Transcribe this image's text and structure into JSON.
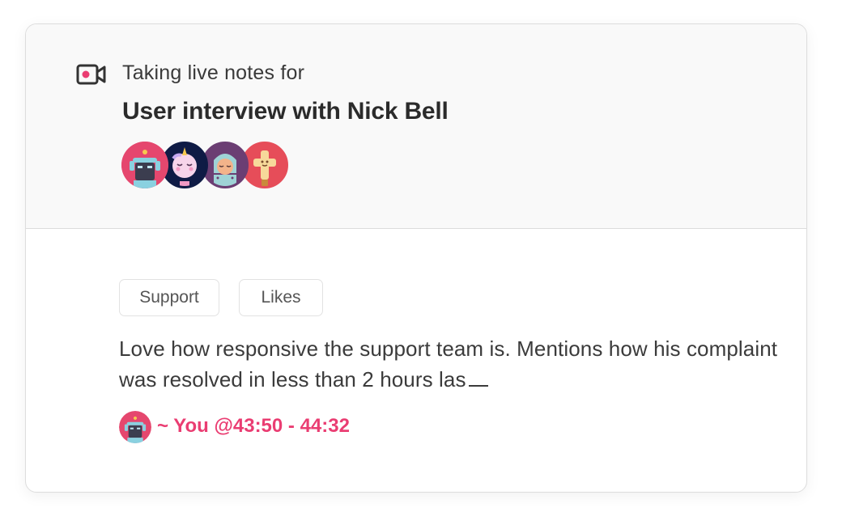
{
  "header": {
    "subtitle": "Taking live notes for",
    "title": "User interview with Nick Bell",
    "record_icon": "video-camera-record-icon",
    "participants": [
      {
        "name": "robot-avatar",
        "bg": "#e5476e"
      },
      {
        "name": "unicorn-avatar",
        "bg": "#0f1b45"
      },
      {
        "name": "knight-avatar",
        "bg": "#6b3e73"
      },
      {
        "name": "cross-avatar",
        "bg": "#e64d59"
      }
    ]
  },
  "note": {
    "tags": [
      "Support",
      "Likes"
    ],
    "text": "Love how responsive the support team is. Mentions how his complaint was resolved in less than 2 hours las",
    "author": "~ You @43:50 - 44:32"
  },
  "colors": {
    "accent": "#ea3d72",
    "header_bg": "#f9f9f9",
    "border": "#dddddd"
  }
}
